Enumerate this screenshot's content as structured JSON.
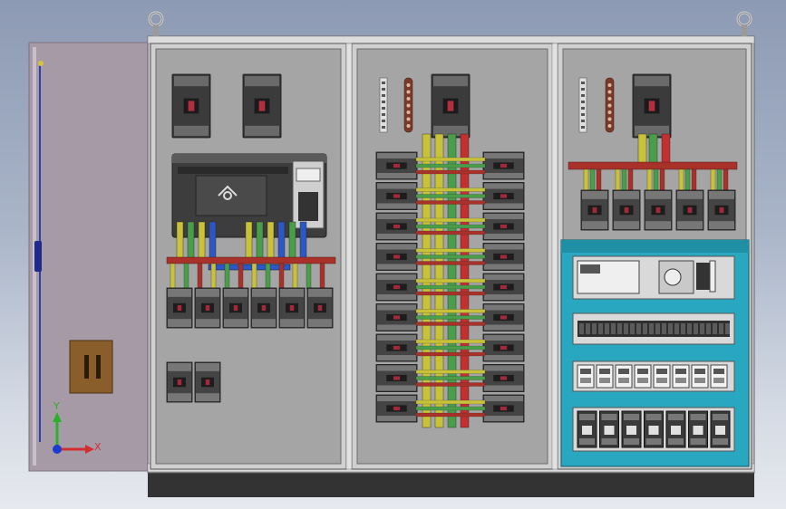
{
  "viewport": {
    "title": ""
  },
  "triad": {
    "x_label": "X",
    "y_label": "Y"
  },
  "colors": {
    "background_top": "#8d9ab3",
    "background_bottom": "#e6e9ee",
    "cabinet_frame": "#c7c7c7",
    "panel": "#a5a5a5",
    "door": "#a79aa7",
    "plinth": "#333333",
    "busbar_red": "#a8322a",
    "busbar_blue": "#2c57c4",
    "wire_yellow": "#c8c23a",
    "wire_green": "#4a9e4a",
    "wire_red": "#c23030",
    "din_teal": "#2aa7c0"
  },
  "icons": [
    "lifting-eye-icon",
    "door-handle-icon",
    "axis-triad-icon"
  ]
}
